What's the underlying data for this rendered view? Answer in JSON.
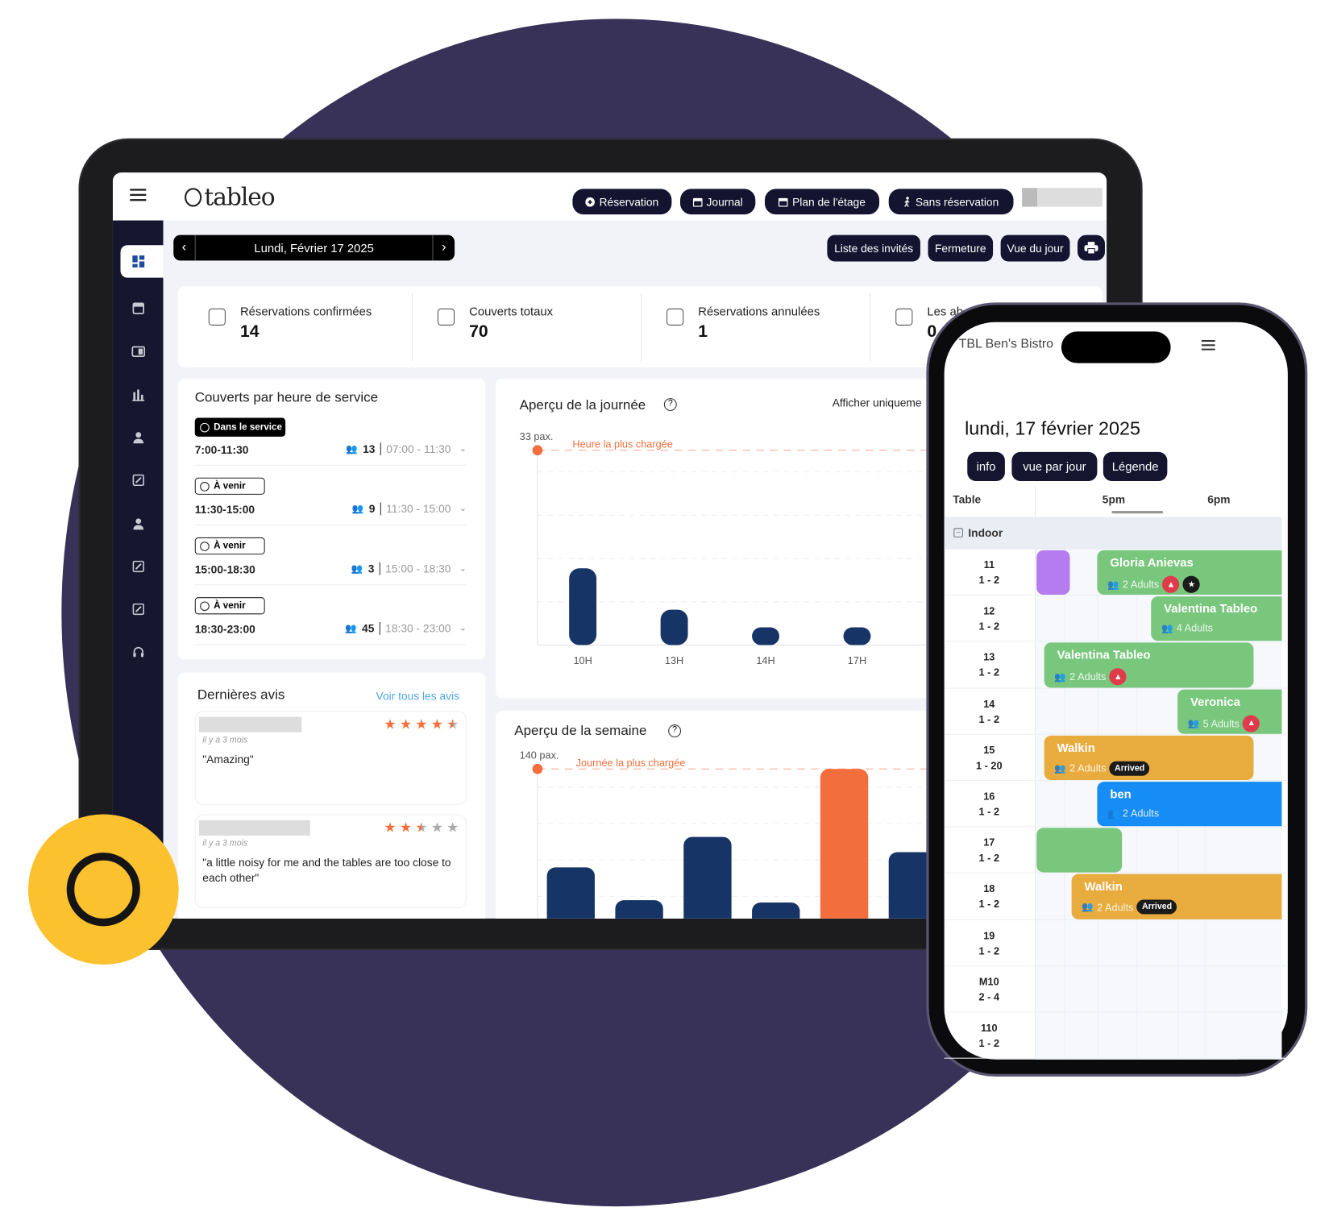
{
  "tablet": {
    "logo": "tableo",
    "top_buttons": [
      {
        "label": "Réservation",
        "icon": "plus-circle-icon"
      },
      {
        "label": "Journal",
        "icon": "calendar-icon"
      },
      {
        "label": "Plan de l'étage",
        "icon": "calendar-icon"
      },
      {
        "label": "Sans réservation",
        "icon": "walking-icon"
      }
    ],
    "date_label": "Lundi, Février 17 2025",
    "action_buttons": [
      "Liste des invités",
      "Fermeture",
      "Vue du jour"
    ],
    "sidebar_icons": [
      "dashboard-icon",
      "calendar-icon",
      "card-icon",
      "bar-chart-icon",
      "user-icon",
      "edit-icon",
      "user-icon",
      "edit-icon",
      "edit-icon",
      "headset-icon"
    ],
    "stats": [
      {
        "label": "Réservations confirmées",
        "value": "14",
        "icon": "thumbs-up-icon"
      },
      {
        "label": "Couverts totaux",
        "value": "70",
        "icon": "dining-icon"
      },
      {
        "label": "Réservations annulées",
        "value": "1",
        "icon": "calendar-cancel-icon"
      },
      {
        "label": "Les ab",
        "value": "0",
        "icon": "thumbs-down-icon"
      }
    ],
    "services": {
      "title": "Couverts par heure de service",
      "rows": [
        {
          "status": "Dans le service",
          "active": true,
          "time": "7:00-11:30",
          "covers": "13",
          "range": "07:00 - 11:30"
        },
        {
          "status": "À venir",
          "active": false,
          "time": "11:30-15:00",
          "covers": "9",
          "range": "11:30 - 15:00"
        },
        {
          "status": "À venir",
          "active": false,
          "time": "15:00-18:30",
          "covers": "3",
          "range": "15:00 - 18:30"
        },
        {
          "status": "À venir",
          "active": false,
          "time": "18:30-23:00",
          "covers": "45",
          "range": "18:30 - 23:00"
        }
      ]
    },
    "reviews": {
      "title": "Dernières avis",
      "link": "Voir tous les avis",
      "items": [
        {
          "ago": "il y a 3 mois",
          "text": "\"Amazing\"",
          "rating": 4.5
        },
        {
          "ago": "il y a 3 mois",
          "text": "\"a little noisy for me and the tables are too close to each other\"",
          "rating": 2.5
        }
      ]
    },
    "day_overview": {
      "title": "Aperçu de la journée",
      "filter": "Afficher uniqueme"
    },
    "week_overview": {
      "title": "Aperçu de la semaine"
    }
  },
  "chart_data": [
    {
      "type": "bar",
      "title": "Aperçu de la journée",
      "categories": [
        "10H",
        "13H",
        "14H",
        "17H"
      ],
      "values": [
        13,
        6,
        3,
        3
      ],
      "ylim": [
        0,
        33
      ],
      "max_label": "33 pax.",
      "annotation": "Heure la plus chargée",
      "grid": true,
      "colors": {
        "bar": "#163566",
        "highlight": "#f26f3d"
      }
    },
    {
      "type": "bar",
      "title": "Aperçu de la semaine",
      "values": [
        56,
        28,
        82,
        26,
        140,
        69
      ],
      "ylim": [
        0,
        140
      ],
      "max_label": "140 pax.",
      "annotation": "Journée la plus chargée",
      "grid": true,
      "colors": {
        "bar": "#163566",
        "highlight": "#f26f3d"
      }
    }
  ],
  "phone": {
    "venue": "TBL Ben's Bistro",
    "date": "lundi, 17 février 2025",
    "buttons": [
      "info",
      "vue par jour",
      "Légende"
    ],
    "table_header": "Table",
    "times": [
      "5pm",
      "6pm"
    ],
    "section": "Indoor",
    "tables": [
      {
        "num": "11",
        "cap": "1 - 2"
      },
      {
        "num": "12",
        "cap": "1 - 2"
      },
      {
        "num": "13",
        "cap": "1 - 2"
      },
      {
        "num": "14",
        "cap": "1 - 2"
      },
      {
        "num": "15",
        "cap": "1 - 20"
      },
      {
        "num": "16",
        "cap": "1 - 2"
      },
      {
        "num": "17",
        "cap": "1 - 2"
      },
      {
        "num": "18",
        "cap": "1 - 2"
      },
      {
        "num": "19",
        "cap": "1 - 2"
      },
      {
        "num": "M10",
        "cap": "2 - 4"
      },
      {
        "num": "110",
        "cap": "1 - 2"
      }
    ],
    "bookings": [
      {
        "table": "11",
        "name": "",
        "guests": "",
        "color": "#b57cf0"
      },
      {
        "table": "11",
        "name": "Gloria Anievas",
        "guests": "2 Adults",
        "color": "#79c67d",
        "bell": true,
        "star": true
      },
      {
        "table": "12",
        "name": "Valentina Tableo",
        "guests": "4 Adults",
        "color": "#79c67d"
      },
      {
        "table": "13",
        "name": "Valentina Tableo",
        "guests": "2 Adults",
        "color": "#79c67d",
        "bell": true
      },
      {
        "table": "14",
        "name": "Veronica",
        "guests": "5 Adults",
        "color": "#79c67d",
        "bell": true
      },
      {
        "table": "15",
        "name": "Walkin",
        "guests": "2 Adults",
        "color": "#e8ab3e",
        "status": "Arrived"
      },
      {
        "table": "16",
        "name": "ben",
        "guests": "2 Adults",
        "color": "#168cf5"
      },
      {
        "table": "17",
        "name": "",
        "guests": "",
        "color": "#79c67d"
      },
      {
        "table": "18",
        "name": "Walkin",
        "guests": "2 Adults",
        "color": "#e8ab3e",
        "status": "Arrived"
      }
    ]
  }
}
